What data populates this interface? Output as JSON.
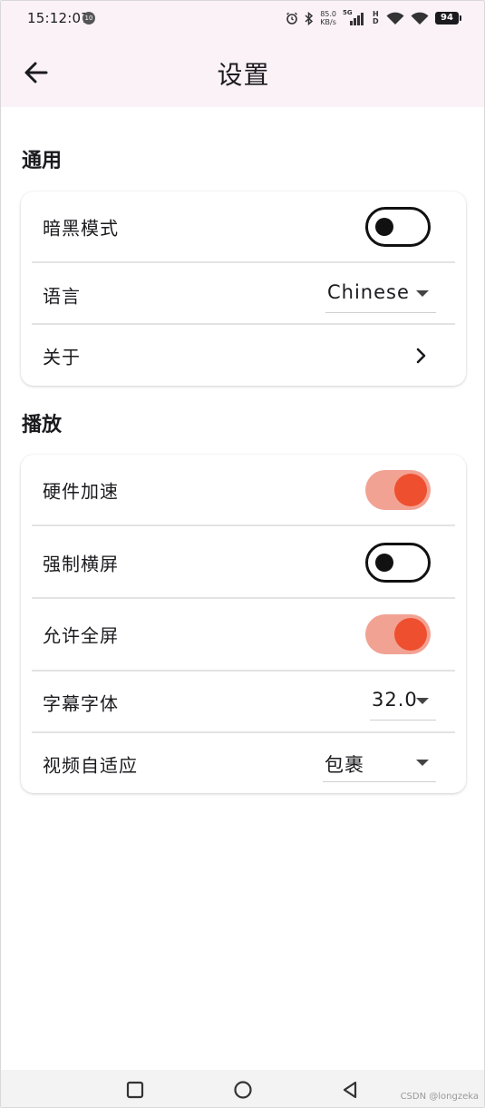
{
  "status_bar": {
    "time": "15:12:07",
    "notification_badge": "10",
    "net_speed_value": "85.0",
    "net_speed_unit": "KB/s",
    "signal_tag": "5G",
    "hd_tag": "HD",
    "battery": "94"
  },
  "app_bar": {
    "title": "设置"
  },
  "sections": {
    "general": {
      "title": "通用",
      "dark_mode": {
        "label": "暗黑模式",
        "enabled": false
      },
      "language": {
        "label": "语言",
        "value": "Chinese"
      },
      "about": {
        "label": "关于"
      }
    },
    "playback": {
      "title": "播放",
      "hw_accel": {
        "label": "硬件加速",
        "enabled": true
      },
      "force_landscape": {
        "label": "强制横屏",
        "enabled": false
      },
      "allow_fullscreen": {
        "label": "允许全屏",
        "enabled": true
      },
      "subtitle_font": {
        "label": "字幕字体",
        "value": "32.0"
      },
      "video_fit": {
        "label": "视频自适应",
        "value": "包裹"
      }
    }
  },
  "watermark": "CSDN @longzeka",
  "colors": {
    "switch_on_track": "#f2a293",
    "switch_on_knob": "#ee4f2e",
    "appbar_bg": "#fbf2f8"
  }
}
